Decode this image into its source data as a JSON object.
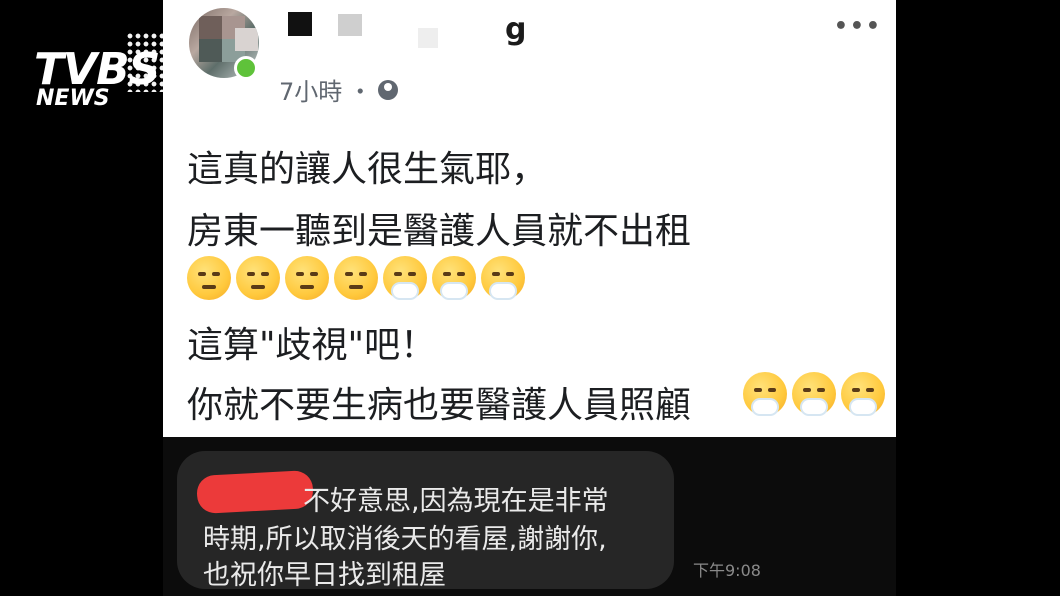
{
  "post": {
    "author_visible_letter": "g",
    "time": "7小時",
    "separator": "・",
    "privacy_icon": "globe-icon",
    "more_icon": "more-horizontal-icon",
    "lines": [
      "這真的讓人很生氣耶，",
      "房東一聽到是醫護人員就不出租",
      "這算\"歧視\"吧！",
      "你就不要生病也要醫護人員照顧"
    ],
    "emoji_row_1": [
      "angry-face",
      "angry-face",
      "angry-face",
      "angry-face",
      "steam-face",
      "steam-face",
      "steam-face"
    ],
    "emoji_row_2": [
      "steam-face",
      "steam-face",
      "steam-face"
    ]
  },
  "chat": {
    "message_lines": [
      "不好意思,因為現在是非常",
      "時期,所以取消後天的看屋,謝謝你,",
      "也祝你早日找到租屋"
    ],
    "timestamp": "下午9:08"
  },
  "watermark": {
    "brand": "TVBS",
    "sub": "NEWS"
  },
  "colors": {
    "background": "#000000",
    "post_bg": "#ffffff",
    "chat_bg": "#0c0c0c",
    "bubble_bg": "#262626",
    "redaction": "#ec3a3a",
    "online": "#5fc23a"
  }
}
